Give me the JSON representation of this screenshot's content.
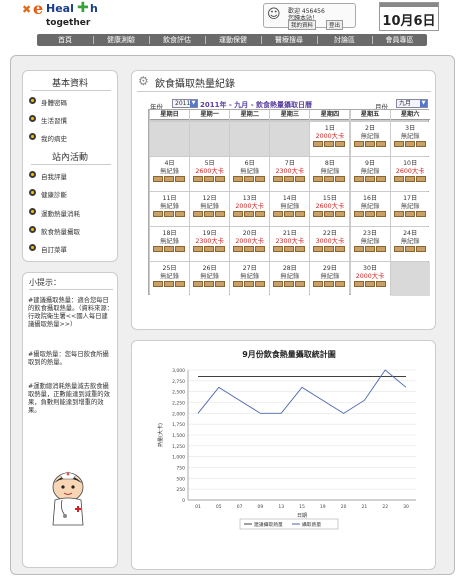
{
  "header": {
    "logo_e": "e",
    "logo_heal": "Heal",
    "logo_h": "h",
    "logo_together": "together",
    "user": {
      "welcome": "歡迎 456456",
      "visit": "您歸本站！",
      "btn_my_data": "我的資料",
      "btn_logout": "登出"
    },
    "date": "10月6日"
  },
  "nav": [
    "首頁",
    "健康測驗",
    "飲食評估",
    "運動保健",
    "醫療搜尋",
    "討論區",
    "會員專區"
  ],
  "sidebar": {
    "basic_title": "基本資料",
    "basic_items": [
      "身體密碼",
      "生活習慣",
      "我的病史"
    ],
    "site_title": "站內活動",
    "site_items": [
      "自我評量",
      "健康診斷",
      "運動熱量消耗",
      "飲食熱量攝取",
      "自訂菜單"
    ]
  },
  "tips": {
    "title": "小提示：",
    "p1": "#建議攝取熱量：適合您每日的飲食攝取熱量。（資料來源：行政院衛生署<<國人每日建議攝取熱量>>）",
    "p2": "#攝取熱量：您每日飲食所攝取到的熱量。",
    "p3": "#運動總消耗熱量減去飲食攝取熱量，正數能達到減重的效果，負數則能達到增重的效果。"
  },
  "calendar": {
    "panel_title": "飲食攝取熱量紀錄",
    "year_label": "年份",
    "year_value": "2011",
    "month_label": "月份",
    "month_value": "九月",
    "title": "2011年 - 九月 - 飲食熱量攝取日曆",
    "weekdays": [
      "星期日",
      "星期一",
      "星期二",
      "星期三",
      "星期四",
      "星期五",
      "星期六"
    ],
    "days": [
      {
        "d": "1日",
        "v": "2000大卡"
      },
      {
        "d": "2日",
        "v": "無紀錄"
      },
      {
        "d": "3日",
        "v": "無紀錄"
      },
      {
        "d": "4日",
        "v": "無紀錄"
      },
      {
        "d": "5日",
        "v": "2600大卡"
      },
      {
        "d": "6日",
        "v": "無紀錄"
      },
      {
        "d": "7日",
        "v": "2300大卡"
      },
      {
        "d": "8日",
        "v": "無紀錄"
      },
      {
        "d": "9日",
        "v": "無紀錄"
      },
      {
        "d": "10日",
        "v": "2600大卡"
      },
      {
        "d": "11日",
        "v": "無紀錄"
      },
      {
        "d": "12日",
        "v": "無紀錄"
      },
      {
        "d": "13日",
        "v": "2000大卡"
      },
      {
        "d": "14日",
        "v": "無紀錄"
      },
      {
        "d": "15日",
        "v": "2600大卡"
      },
      {
        "d": "16日",
        "v": "無紀錄"
      },
      {
        "d": "17日",
        "v": "無紀錄"
      },
      {
        "d": "18日",
        "v": "無紀錄"
      },
      {
        "d": "19日",
        "v": "2300大卡"
      },
      {
        "d": "20日",
        "v": "2000大卡"
      },
      {
        "d": "21日",
        "v": "2300大卡"
      },
      {
        "d": "22日",
        "v": "3000大卡"
      },
      {
        "d": "23日",
        "v": "無紀錄"
      },
      {
        "d": "24日",
        "v": "無紀錄"
      },
      {
        "d": "25日",
        "v": "無紀錄"
      },
      {
        "d": "26日",
        "v": "無紀錄"
      },
      {
        "d": "27日",
        "v": "無紀錄"
      },
      {
        "d": "28日",
        "v": "無紀錄"
      },
      {
        "d": "29日",
        "v": "無紀錄"
      },
      {
        "d": "30日",
        "v": "2000大卡"
      }
    ],
    "kcal_color": "#d42020"
  },
  "chart_data": {
    "type": "line",
    "title": "9月份飲食熱量攝取統計圖",
    "xlabel": "日期",
    "ylabel": "熱量(大卡)",
    "x": [
      "01",
      "05",
      "07",
      "09",
      "13",
      "15",
      "19",
      "20",
      "21",
      "22",
      "30"
    ],
    "ylim": [
      0,
      3000
    ],
    "yticks": [
      "3,000",
      "2,750",
      "2,500",
      "2,250",
      "2,000",
      "1,750",
      "1,500",
      "1,250",
      "1,000",
      "750",
      "500",
      "250",
      "0"
    ],
    "series": [
      {
        "name": "建議攝取熱量",
        "color": "#404040",
        "values": [
          2850,
          2850,
          2850,
          2850,
          2850,
          2850,
          2850,
          2850,
          2850,
          2850,
          2850
        ]
      },
      {
        "name": "攝取熱量",
        "color": "#4a66b0",
        "values": [
          2000,
          2600,
          2300,
          2000,
          2000,
          2600,
          2300,
          2000,
          2300,
          3000,
          2600
        ]
      }
    ],
    "grid": true,
    "legend": "bottom"
  }
}
